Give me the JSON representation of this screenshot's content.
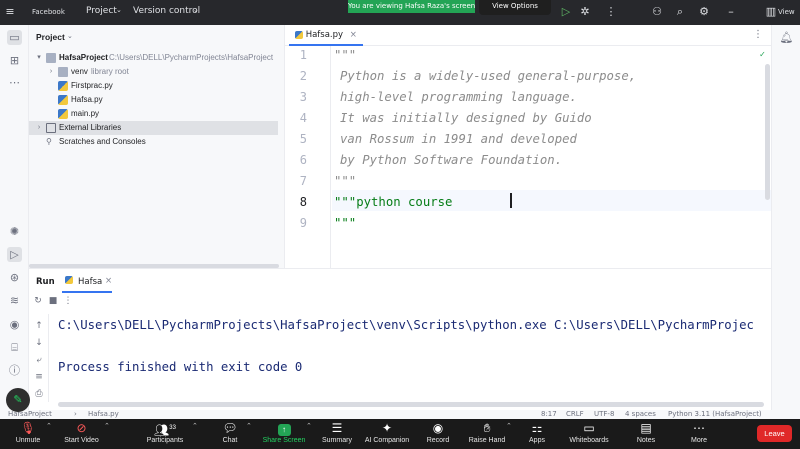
{
  "titlebar": {
    "app_name": "Facebook",
    "project_menu": "Project",
    "vcs_menu": "Version control",
    "share_banner": "You are viewing Hafsa Raza's screen",
    "view_options": "View Options",
    "view_label": "View"
  },
  "project_panel": {
    "header": "Project",
    "tree": [
      {
        "label": "HafsaProject",
        "detail": "C:\\Users\\DELL\\PycharmProjects\\HafsaProject"
      },
      {
        "label": "venv",
        "detail": "library root"
      },
      {
        "label": "Firstprac.py",
        "detail": ""
      },
      {
        "label": "Hafsa.py",
        "detail": ""
      },
      {
        "label": "main.py",
        "detail": ""
      },
      {
        "label": "External Libraries",
        "detail": ""
      },
      {
        "label": "Scratches and Consoles",
        "detail": ""
      }
    ]
  },
  "editor": {
    "tab_label": "Hafsa.py",
    "line_numbers": [
      "1",
      "2",
      "3",
      "4",
      "5",
      "6",
      "7",
      "8",
      "9"
    ],
    "lines": [
      "\"\"\"",
      "Python is a widely-used general-purpose,",
      "high-level programming language.",
      "It was initially designed by Guido",
      "van Rossum in 1991 and developed",
      "by Python Software Foundation.",
      "\"\"\"",
      "\"\"\"python course ",
      "\"\"\""
    ],
    "active_line": 8
  },
  "run_panel": {
    "run_label": "Run",
    "tab_label": "Hafsa",
    "output": [
      "C:\\Users\\DELL\\PycharmProjects\\HafsaProject\\venv\\Scripts\\python.exe C:\\Users\\DELL\\PycharmProjec",
      "",
      "Process finished with exit code 0"
    ]
  },
  "status_bar": {
    "breadcrumb_project": "HafsaProject",
    "breadcrumb_file": "Hafsa.py",
    "position": "8:17",
    "line_sep": "CRLF",
    "encoding": "UTF-8",
    "indent": "4 spaces",
    "interpreter": "Python 3.11 (HafsaProject)"
  },
  "zoom_toolbar": {
    "unmute": "Unmute",
    "start_video": "Start Video",
    "participants": "Participants",
    "participants_count": "33",
    "chat": "Chat",
    "share_screen": "Share Screen",
    "summary": "Summary",
    "ai_companion": "AI Companion",
    "record": "Record",
    "raise_hand": "Raise Hand",
    "apps": "Apps",
    "whiteboards": "Whiteboards",
    "notes": "Notes",
    "more": "More",
    "leave": "Leave"
  },
  "colors": {
    "accent": "#3574f0",
    "share_green": "#23a455",
    "leave_red": "#e02828",
    "docstring_gray": "#8c8c8c",
    "string_green": "#067d17",
    "console_text": "#1a2a73"
  }
}
